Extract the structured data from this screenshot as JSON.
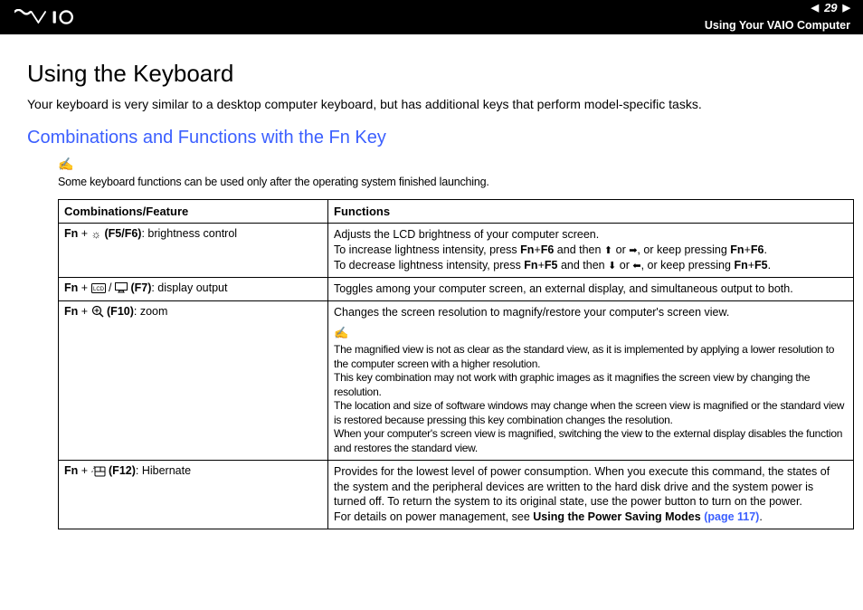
{
  "header": {
    "page_number": "29",
    "chapter": "Using Your VAIO Computer"
  },
  "main": {
    "title": "Using the Keyboard",
    "intro": "Your keyboard is very similar to a desktop computer keyboard, but has additional keys that perform model-specific tasks.",
    "subtitle": "Combinations and Functions with the Fn Key",
    "note": "Some keyboard functions can be used only after the operating system finished launching.",
    "table": {
      "head_combo": "Combinations/Feature",
      "head_func": "Functions",
      "rows": [
        {
          "fn": "Fn",
          "plus1": " + ",
          "keys": "(F5/F6)",
          "feature": ": brightness control",
          "desc_main": "Adjusts the LCD brightness of your computer screen.",
          "desc_inc_a": "To increase lightness intensity, press ",
          "desc_inc_b": "Fn",
          "desc_inc_c": "+",
          "desc_inc_d": "F6",
          "desc_inc_e": " and then ",
          "desc_inc_f": " or ",
          "desc_inc_g": ", or keep pressing ",
          "desc_inc_h": "Fn",
          "desc_inc_i": "+",
          "desc_inc_j": "F6",
          "desc_inc_k": ".",
          "desc_dec_a": "To decrease lightness intensity, press ",
          "desc_dec_b": "Fn",
          "desc_dec_c": "+",
          "desc_dec_d": "F5",
          "desc_dec_e": " and then ",
          "desc_dec_f": " or ",
          "desc_dec_g": ", or keep pressing ",
          "desc_dec_h": "Fn",
          "desc_dec_i": "+",
          "desc_dec_j": "F5",
          "desc_dec_k": "."
        },
        {
          "fn": "Fn",
          "plus1": " + ",
          "keys": "(F7)",
          "feature": ": display output",
          "desc_main": "Toggles among your computer screen, an external display, and simultaneous output to both."
        },
        {
          "fn": "Fn",
          "plus1": " + ",
          "keys": "(F10)",
          "feature": ": zoom",
          "desc_main": "Changes the screen resolution to magnify/restore your computer's screen view.",
          "note1": "The magnified view is not as clear as the standard view, as it is implemented by applying a lower resolution to the computer screen with a higher resolution.",
          "note2": "This key combination may not work with graphic images as it magnifies the screen view by changing the resolution.",
          "note3": "The location and size of software windows may change when the screen view is magnified or the standard view is restored because pressing this key combination changes the resolution.",
          "note4": "When your computer's screen view is magnified, switching the view to the external display disables the function and restores the standard view."
        },
        {
          "fn": "Fn",
          "plus1": " + ",
          "keys": "(F12)",
          "feature": ": Hibernate",
          "desc_main": "Provides for the lowest level of power consumption. When you execute this command, the states of the system and the peripheral devices are written to the hard disk drive and the system power is turned off. To return the system to its original state, use the power button to turn on the power.",
          "desc_link_a": "For details on power management, see ",
          "desc_link_b": "Using the Power Saving Modes ",
          "desc_link_c": "(page 117)",
          "desc_link_d": "."
        }
      ]
    }
  }
}
